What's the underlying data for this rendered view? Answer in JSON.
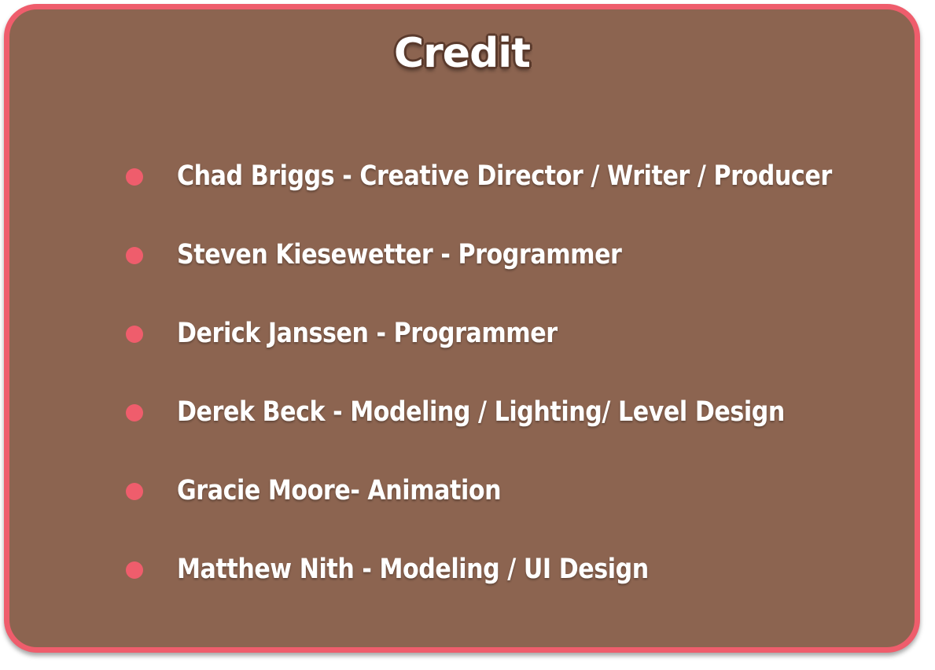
{
  "title": "Credit",
  "colors": {
    "panel_background": "#8c6450",
    "panel_border": "#ef5d6c",
    "bullet": "#ef5d6c",
    "text": "#ffffff"
  },
  "credits": [
    "Chad Briggs - Creative Director / Writer / Producer",
    "Steven Kiesewetter - Programmer",
    "Derick Janssen - Programmer",
    "Derek Beck - Modeling / Lighting/ Level Design",
    "Gracie Moore- Animation",
    "Matthew Nith - Modeling / UI Design"
  ]
}
